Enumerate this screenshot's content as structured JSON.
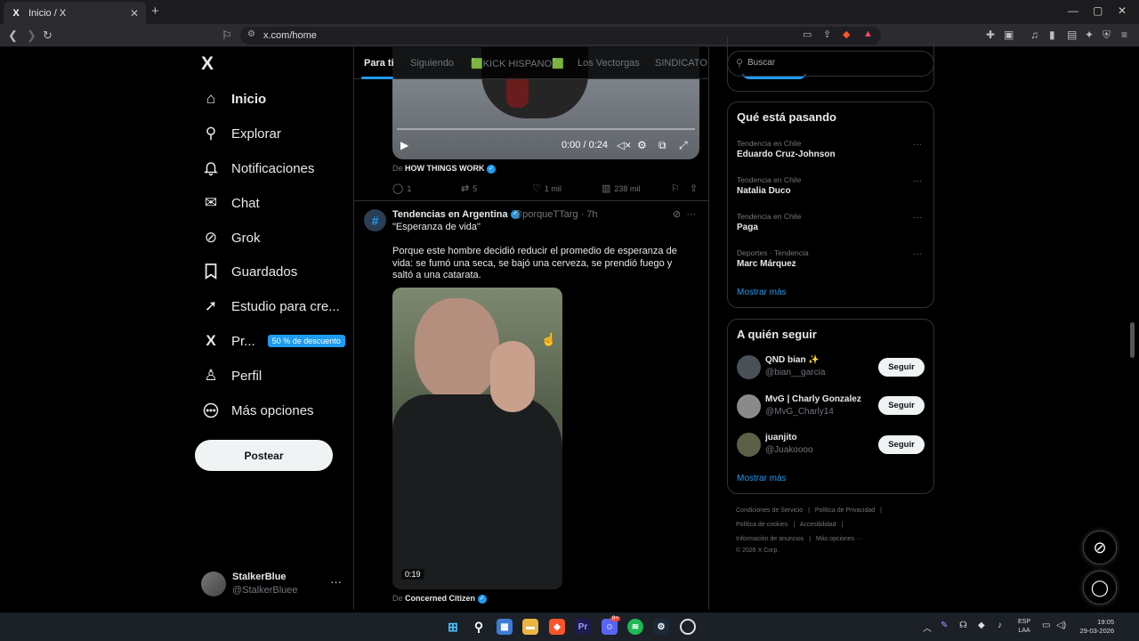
{
  "browser": {
    "tab_title": "Inicio / X",
    "tab_close": "✕",
    "new_tab": "+",
    "url": "x.com/home",
    "window_controls": [
      "—",
      "▢",
      "✕"
    ]
  },
  "left_nav": {
    "logo": "X",
    "items": [
      {
        "label": "Inicio",
        "icon": "home-icon",
        "glyph": "⌂"
      },
      {
        "label": "Explorar",
        "icon": "search-icon",
        "glyph": "⚲"
      },
      {
        "label": "Notificaciones",
        "icon": "bell-icon",
        "glyph": "♫"
      },
      {
        "label": "Chat",
        "icon": "mail-icon",
        "glyph": "✉"
      },
      {
        "label": "Grok",
        "icon": "grok-icon",
        "glyph": "⊘"
      },
      {
        "label": "Guardados",
        "icon": "bookmark-icon",
        "glyph": "⚑"
      },
      {
        "label": "Estudio para cre...",
        "icon": "rocket-icon",
        "glyph": "➚"
      },
      {
        "label": "Pr...",
        "icon": "x-premium-icon",
        "glyph": "X"
      },
      {
        "label": "Perfil",
        "icon": "person-icon",
        "glyph": "♙"
      },
      {
        "label": "Más opciones",
        "icon": "more-circle-icon",
        "glyph": "⋯"
      }
    ],
    "promo_badge": "50 % de descuento",
    "post_button": "Postear",
    "account": {
      "name": "StalkerBlue",
      "handle": "@StalkerBluee",
      "more": "···"
    }
  },
  "feed": {
    "tabs": [
      "Para ti",
      "Siguiendo",
      "🟩KICK HISPANO🟩",
      "Los Vectorgas",
      "SINDICATO D"
    ],
    "video1": {
      "time": "0:00 / 0:24"
    },
    "post1": {
      "source_prefix": "De",
      "source": "HOW THINGS WORK",
      "replies": "1",
      "reposts": "5",
      "likes": "1 mil",
      "views": "238 mil"
    },
    "post2": {
      "author": "Tendencias en Argentina",
      "handle_time": "@porqueTTarg · 7h",
      "quote": "\"Esperanza de vida\"",
      "body": "Porque este hombre decidió reducir el promedio de esperanza de vida: se fumó una seca, se bajó una cerveza, se prendió fuego y saltó a una catarata.",
      "video_duration": "0:19",
      "source_prefix": "De",
      "source": "Concerned Citizen"
    }
  },
  "right": {
    "search_placeholder": "Buscar",
    "trends_title": "Qué está pasando",
    "trends": [
      {
        "context": "Tendencia en Chile",
        "name": "Eduardo Cruz-Johnson"
      },
      {
        "context": "Tendencia en Chile",
        "name": "Natalia Duco"
      },
      {
        "context": "Tendencia en Chile",
        "name": "Paga"
      },
      {
        "context": "Deportes · Tendencia",
        "name": "Marc Márquez"
      }
    ],
    "trends_more": "Mostrar más",
    "who_title": "A quién seguir",
    "who": [
      {
        "name": "QND bian ✨",
        "handle": "@bian__garcia",
        "button": "Seguir"
      },
      {
        "name": "MvG | Charly Gonzalez",
        "handle": "@MvG_Charly14",
        "button": "Seguir"
      },
      {
        "name": "juanjito",
        "handle": "@Juakoooo",
        "button": "Seguir"
      }
    ],
    "who_more": "Mostrar más",
    "footer": [
      [
        "Condiciones de Servicio",
        "|",
        "Política de Privacidad",
        "|"
      ],
      [
        "Política de cookies",
        "|",
        "Accesibilidad",
        "|"
      ],
      [
        "Información de anuncios",
        "|",
        "Más opciones ···"
      ],
      [
        "© 2026 X Corp."
      ]
    ]
  },
  "taskbar": {
    "lang": [
      "ESP",
      "LAA"
    ],
    "time": "19:05",
    "date": "29-03-2026",
    "discord_badge": "9+"
  }
}
